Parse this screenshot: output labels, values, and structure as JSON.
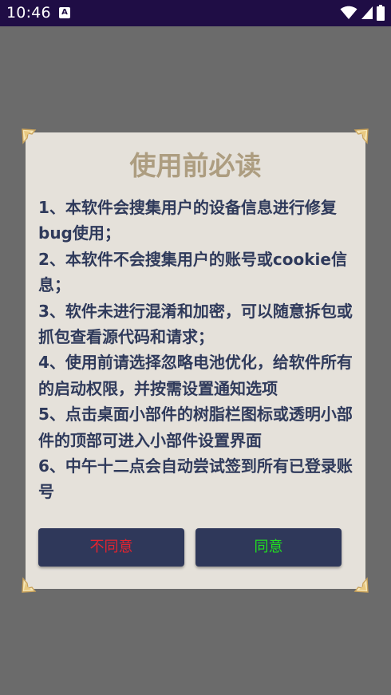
{
  "status_bar": {
    "time": "10:46",
    "notification_letter": "A",
    "icons": [
      "wifi-icon",
      "signal-icon",
      "battery-icon"
    ]
  },
  "dialog": {
    "title": "使用前必读",
    "items": [
      "1、本软件会搜集用户的设备信息进行修复bug使用；",
      "2、本软件不会搜集用户的账号或cookie信息；",
      "3、软件未进行混淆和加密，可以随意拆包或抓包查看源代码和请求；",
      "4、使用前请选择忽略电池优化，给软件所有的启动权限，并按需设置通知选项",
      "5、点击桌面小部件的树脂栏图标或透明小部件的顶部可进入小部件设置界面",
      "6、中午十二点会自动尝试签到所有已登录账号"
    ],
    "disagree_label": "不同意",
    "agree_label": "同意"
  },
  "colors": {
    "status_bar": "#1f0d45",
    "backdrop": "#6b6b6b",
    "dialog_bg": "#e5e1da",
    "title": "#ad9d80",
    "body_text": "#2f3a5b",
    "button_bg": "#2f385a",
    "disagree_text": "#e6232e",
    "agree_text": "#21e21f"
  }
}
